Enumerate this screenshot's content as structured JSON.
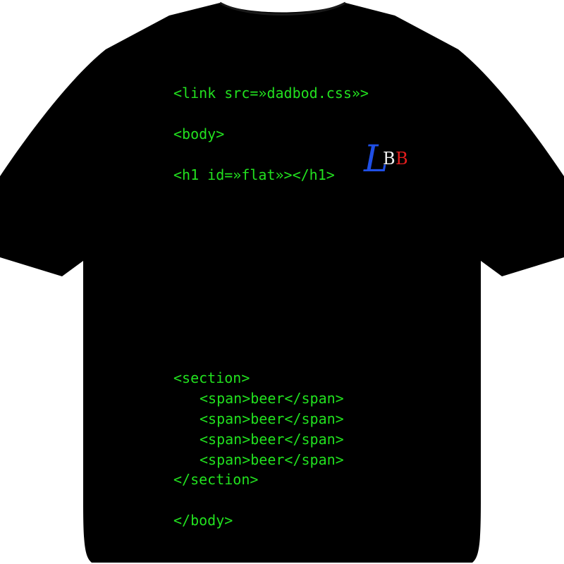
{
  "shirt": {
    "color": "#000000",
    "code_color": "#22e11f",
    "background": "#ffffff"
  },
  "code": {
    "line1": "<link src=»dadbod.css»>",
    "line2": "<body>",
    "line3": "<h1 id=»flat»></h1>",
    "line4": "<section>",
    "span_lines": [
      "<span>beer</span>",
      "<span>beer</span>",
      "<span>beer</span>",
      "<span>beer</span>"
    ],
    "line9": "</section>",
    "line10": "</body>"
  },
  "logo": {
    "letter_l": "L",
    "letter_b1": "B",
    "letter_b2": "B",
    "colors": {
      "l": "#1f4fe6",
      "b1": "#f2f2f2",
      "b2": "#e21d1d"
    }
  }
}
